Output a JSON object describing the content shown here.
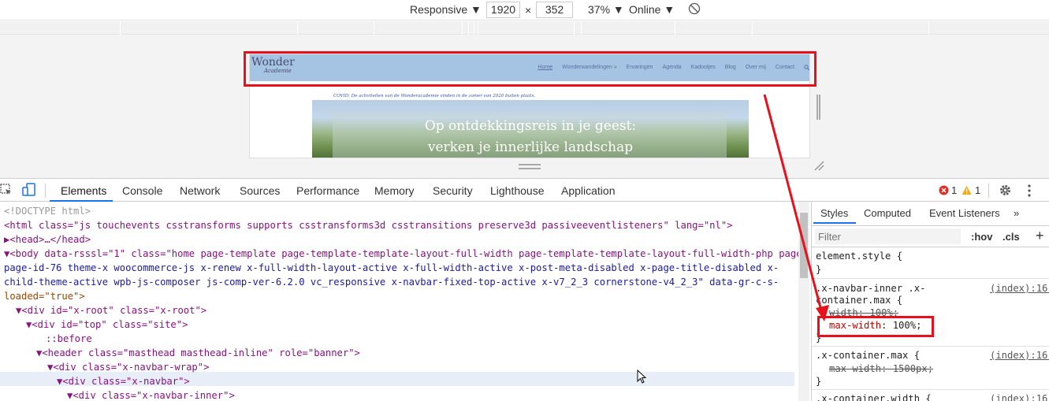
{
  "toolbar": {
    "device": "Responsive",
    "width": "1920",
    "times": "×",
    "height": "352",
    "zoom": "37%",
    "throttle": "Online"
  },
  "site": {
    "logo": "Wonder",
    "logo_sub": "Academie",
    "nav": [
      "Home",
      "Wonderwandelingen »",
      "Ervaringen",
      "Agenda",
      "Kadootjes",
      "Blog",
      "Over mij",
      "Contact"
    ],
    "covid": "COVID: De activiteiten van de Wonderacademie vinden in de zomer van 2020 buiten plaats.",
    "hero_line1": "Op ontdekkingsreis in je geest:",
    "hero_line2": "verken je innerlijke landschap"
  },
  "devtools": {
    "tabs": [
      "Elements",
      "Console",
      "Network",
      "Sources",
      "Performance",
      "Memory",
      "Security",
      "Lighthouse",
      "Application"
    ],
    "errors": "1",
    "warnings": "1",
    "styles_tabs": [
      "Styles",
      "Computed",
      "Event Listeners"
    ],
    "filter_placeholder": "Filter",
    "hov": ":hov",
    "cls": ".cls",
    "plus": "+"
  },
  "dom": [
    "<!DOCTYPE html>",
    "<html class=\"js touchevents csstransforms supports csstransforms3d csstransitions preserve3d passiveeventlisteners\" lang=\"nl\">",
    "▶<head>…</head>",
    "▼<body data-rsssl=\"1\" class=\"home page-template page-template-template-layout-full-width page-template-template-layout-full-width-php page",
    "page-id-76 theme-x woocommerce-js x-renew x-full-width-layout-active x-full-width-active x-post-meta-disabled x-page-title-disabled x-",
    "child-theme-active wpb-js-composer js-comp-ver-6.2.0 vc_responsive x-navbar-fixed-top-active x-v7_2_3 cornerstone-v4_2_3\" data-gr-c-s-",
    "loaded=\"true\">",
    "▼<div id=\"x-root\" class=\"x-root\">",
    "▼<div id=\"top\" class=\"site\">",
    "::before",
    "▼<header class=\"masthead masthead-inline\" role=\"banner\">",
    "▼<div class=\"x-navbar-wrap\">",
    "▼<div class=\"x-navbar\">",
    "▼<div class=\"x-navbar-inner\">"
  ],
  "styles": {
    "rule1": "element.style {",
    "rule1_close": "}",
    "rule2_sel1": ".x-navbar-inner .x-",
    "rule2_sel2": "container.max {",
    "rule2_p1": "width: 100%;",
    "rule2_p2_name": "max-width",
    "rule2_p2_val": ": 100%;",
    "rule2_close": "}",
    "rule2_src": "(index):16(",
    "rule3_sel": ".x-container.max {",
    "rule3_p1": "max-width: 1500px;",
    "rule3_close": "}",
    "rule3_src": "(index):16(",
    "rule4_sel": ".x-container.width {",
    "rule4_src": "(index):16("
  },
  "colors": {
    "highlight": "#e8101a",
    "accent": "#1a73e8"
  }
}
